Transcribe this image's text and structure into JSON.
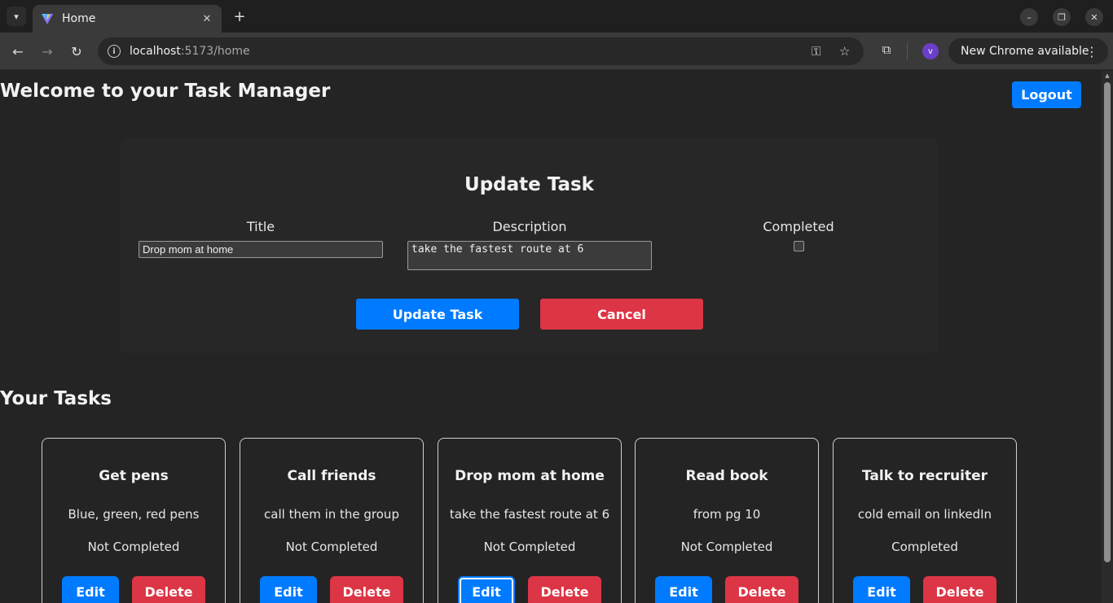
{
  "browser": {
    "tab_title": "Home",
    "url_host": "localhost",
    "url_rest": ":5173/home",
    "update_chip": "New Chrome available",
    "profile_initial": "v"
  },
  "header": {
    "title": "Welcome to your Task Manager",
    "logout_label": "Logout"
  },
  "form": {
    "heading": "Update Task",
    "title_label": "Title",
    "description_label": "Description",
    "completed_label": "Completed",
    "title_value": "Drop mom at home",
    "description_value": "take the fastest route at 6",
    "completed": false,
    "update_label": "Update Task",
    "cancel_label": "Cancel"
  },
  "tasks": {
    "heading": "Your Tasks",
    "edit_label": "Edit",
    "delete_label": "Delete",
    "items": [
      {
        "title": "Get pens",
        "description": "Blue, green, red pens",
        "status": "Not Completed"
      },
      {
        "title": "Call friends",
        "description": "call them in the group",
        "status": "Not Completed"
      },
      {
        "title": "Drop mom at home",
        "description": "take the fastest route at 6",
        "status": "Not Completed"
      },
      {
        "title": "Read book",
        "description": "from pg 10",
        "status": "Not Completed"
      },
      {
        "title": "Talk to recruiter",
        "description": "cold email on linkedIn",
        "status": "Completed"
      }
    ]
  },
  "colors": {
    "primary": "#007bff",
    "danger": "#dc3545",
    "background": "#242424"
  }
}
